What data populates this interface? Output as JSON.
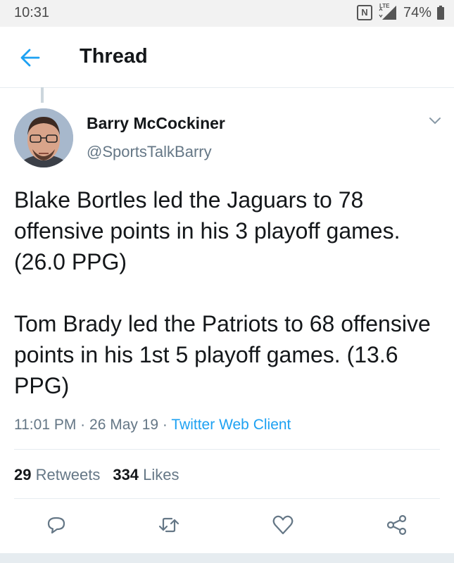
{
  "status_bar": {
    "time": "10:31",
    "battery_percent": "74%",
    "network_label": "LTE",
    "icons": [
      "nfc-icon",
      "signal-icon",
      "battery-icon"
    ]
  },
  "header": {
    "title": "Thread",
    "back_icon": "arrow-left-icon",
    "accent_color": "#1da1f2"
  },
  "tweet": {
    "author": {
      "display_name": "Barry McCockiner",
      "handle": "@SportsTalkBarry"
    },
    "paragraphs": [
      "Blake Bortles led the Jaguars to 78 offensive points in his 3 playoff games. (26.0 PPG)",
      "Tom Brady led the Patriots to 68 offensive points in his 1st 5 playoff games. (13.6 PPG)"
    ],
    "time": "11:01 PM",
    "date": "26 May 19",
    "separator": "·",
    "client": "Twitter Web Client",
    "retweets_count": "29",
    "retweets_label": "Retweets",
    "likes_count": "334",
    "likes_label": "Likes",
    "action_icons": [
      "reply-icon",
      "retweet-icon",
      "like-icon",
      "share-icon"
    ]
  }
}
